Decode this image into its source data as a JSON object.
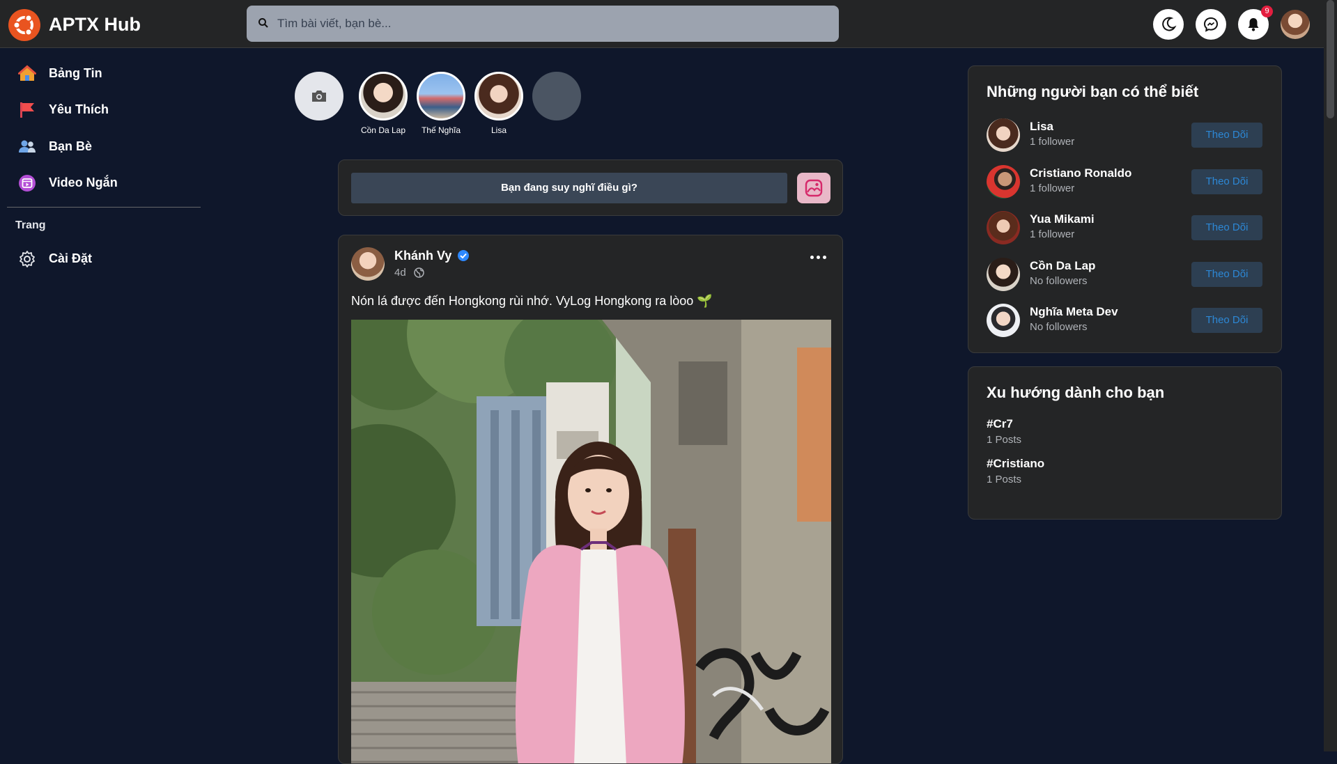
{
  "header": {
    "brand": "APTX Hub",
    "search_placeholder": "Tìm bài viết, bạn bè...",
    "notification_count": "9"
  },
  "sidebar": {
    "items": [
      {
        "label": "Bảng Tin",
        "icon": "home-icon"
      },
      {
        "label": "Yêu Thích",
        "icon": "flag-icon"
      },
      {
        "label": "Bạn Bè",
        "icon": "friends-icon"
      },
      {
        "label": "Video Ngắn",
        "icon": "video-icon"
      }
    ],
    "section_heading": "Trang",
    "settings_label": "Cài Đặt"
  },
  "stories": [
    {
      "name": "Cồn Da Lap"
    },
    {
      "name": "Thế Nghĩa"
    },
    {
      "name": "Lisa"
    }
  ],
  "composer": {
    "prompt": "Bạn đang suy nghĩ điều gì?"
  },
  "post": {
    "author": "Khánh Vy",
    "time": "4d",
    "text": "Nón lá được đến Hongkong rùi nhớ. VyLog Hongkong ra lòoo 🌱"
  },
  "suggestions": {
    "title": "Những người bạn có thể biết",
    "follow_label": "Theo Dõi",
    "people": [
      {
        "name": "Lisa",
        "followers": "1 follower"
      },
      {
        "name": "Cristiano Ronaldo",
        "followers": "1 follower"
      },
      {
        "name": "Yua Mikami",
        "followers": "1 follower"
      },
      {
        "name": "Cồn Da Lap",
        "followers": "No followers"
      },
      {
        "name": "Nghĩa Meta Dev",
        "followers": "No followers"
      }
    ]
  },
  "trends": {
    "title": "Xu hướng dành cho bạn",
    "items": [
      {
        "tag": "#Cr7",
        "count": "1 Posts"
      },
      {
        "tag": "#Cristiano",
        "count": "1 Posts"
      }
    ]
  },
  "colors": {
    "background": "#0f172b",
    "card": "#242526",
    "accent": "#2d88d6",
    "logo": "#e95420",
    "badge": "#e41e3f"
  }
}
